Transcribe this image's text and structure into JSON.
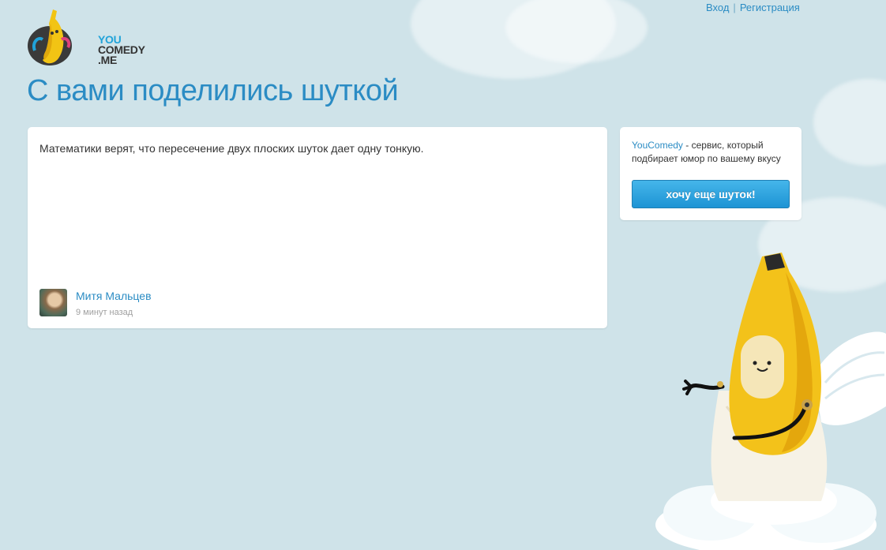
{
  "header": {
    "login_label": "Вход",
    "separator": "|",
    "register_label": "Регистрация"
  },
  "logo": {
    "line1": "YOU",
    "line2": "COMEDY",
    "line3": ".ME"
  },
  "page_title": "С вами поделились шуткой",
  "joke": {
    "text": "Математики верят, что пересечение двух плоских шуток дает одну тонкую.",
    "author_name": "Митя Мальцев",
    "time": "9 минут назад"
  },
  "promo": {
    "brand": "YouComedy",
    "description": " - сервис, который подбирает юмор по вашему вкусу",
    "button_label": "хочу еще шуток!"
  },
  "colors": {
    "background": "#cfe3e9",
    "accent": "#2b8cc4",
    "button": "#1d94d4"
  },
  "icons": {
    "logo": "banana-logo-icon",
    "mascot": "banana-angel-mascot"
  }
}
